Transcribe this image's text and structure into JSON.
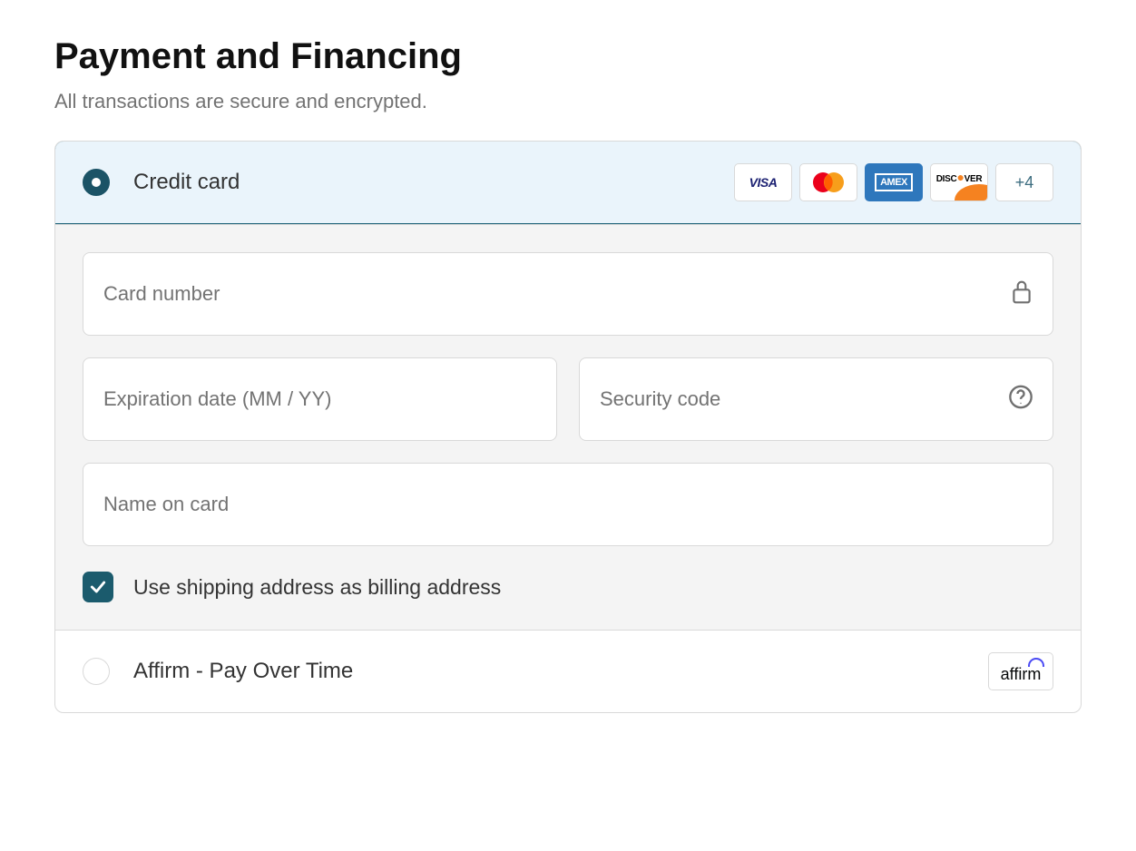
{
  "header": {
    "title": "Payment and Financing",
    "subtitle": "All transactions are secure and encrypted."
  },
  "options": {
    "credit_card": {
      "label": "Credit card",
      "selected": true,
      "more_badge": "+4"
    },
    "affirm": {
      "label": "Affirm - Pay Over Time",
      "selected": false
    }
  },
  "form": {
    "card_number_placeholder": "Card number",
    "expiration_placeholder": "Expiration date (MM / YY)",
    "security_placeholder": "Security code",
    "name_placeholder": "Name on card"
  },
  "checkbox": {
    "label": "Use shipping address as billing address",
    "checked": true
  }
}
